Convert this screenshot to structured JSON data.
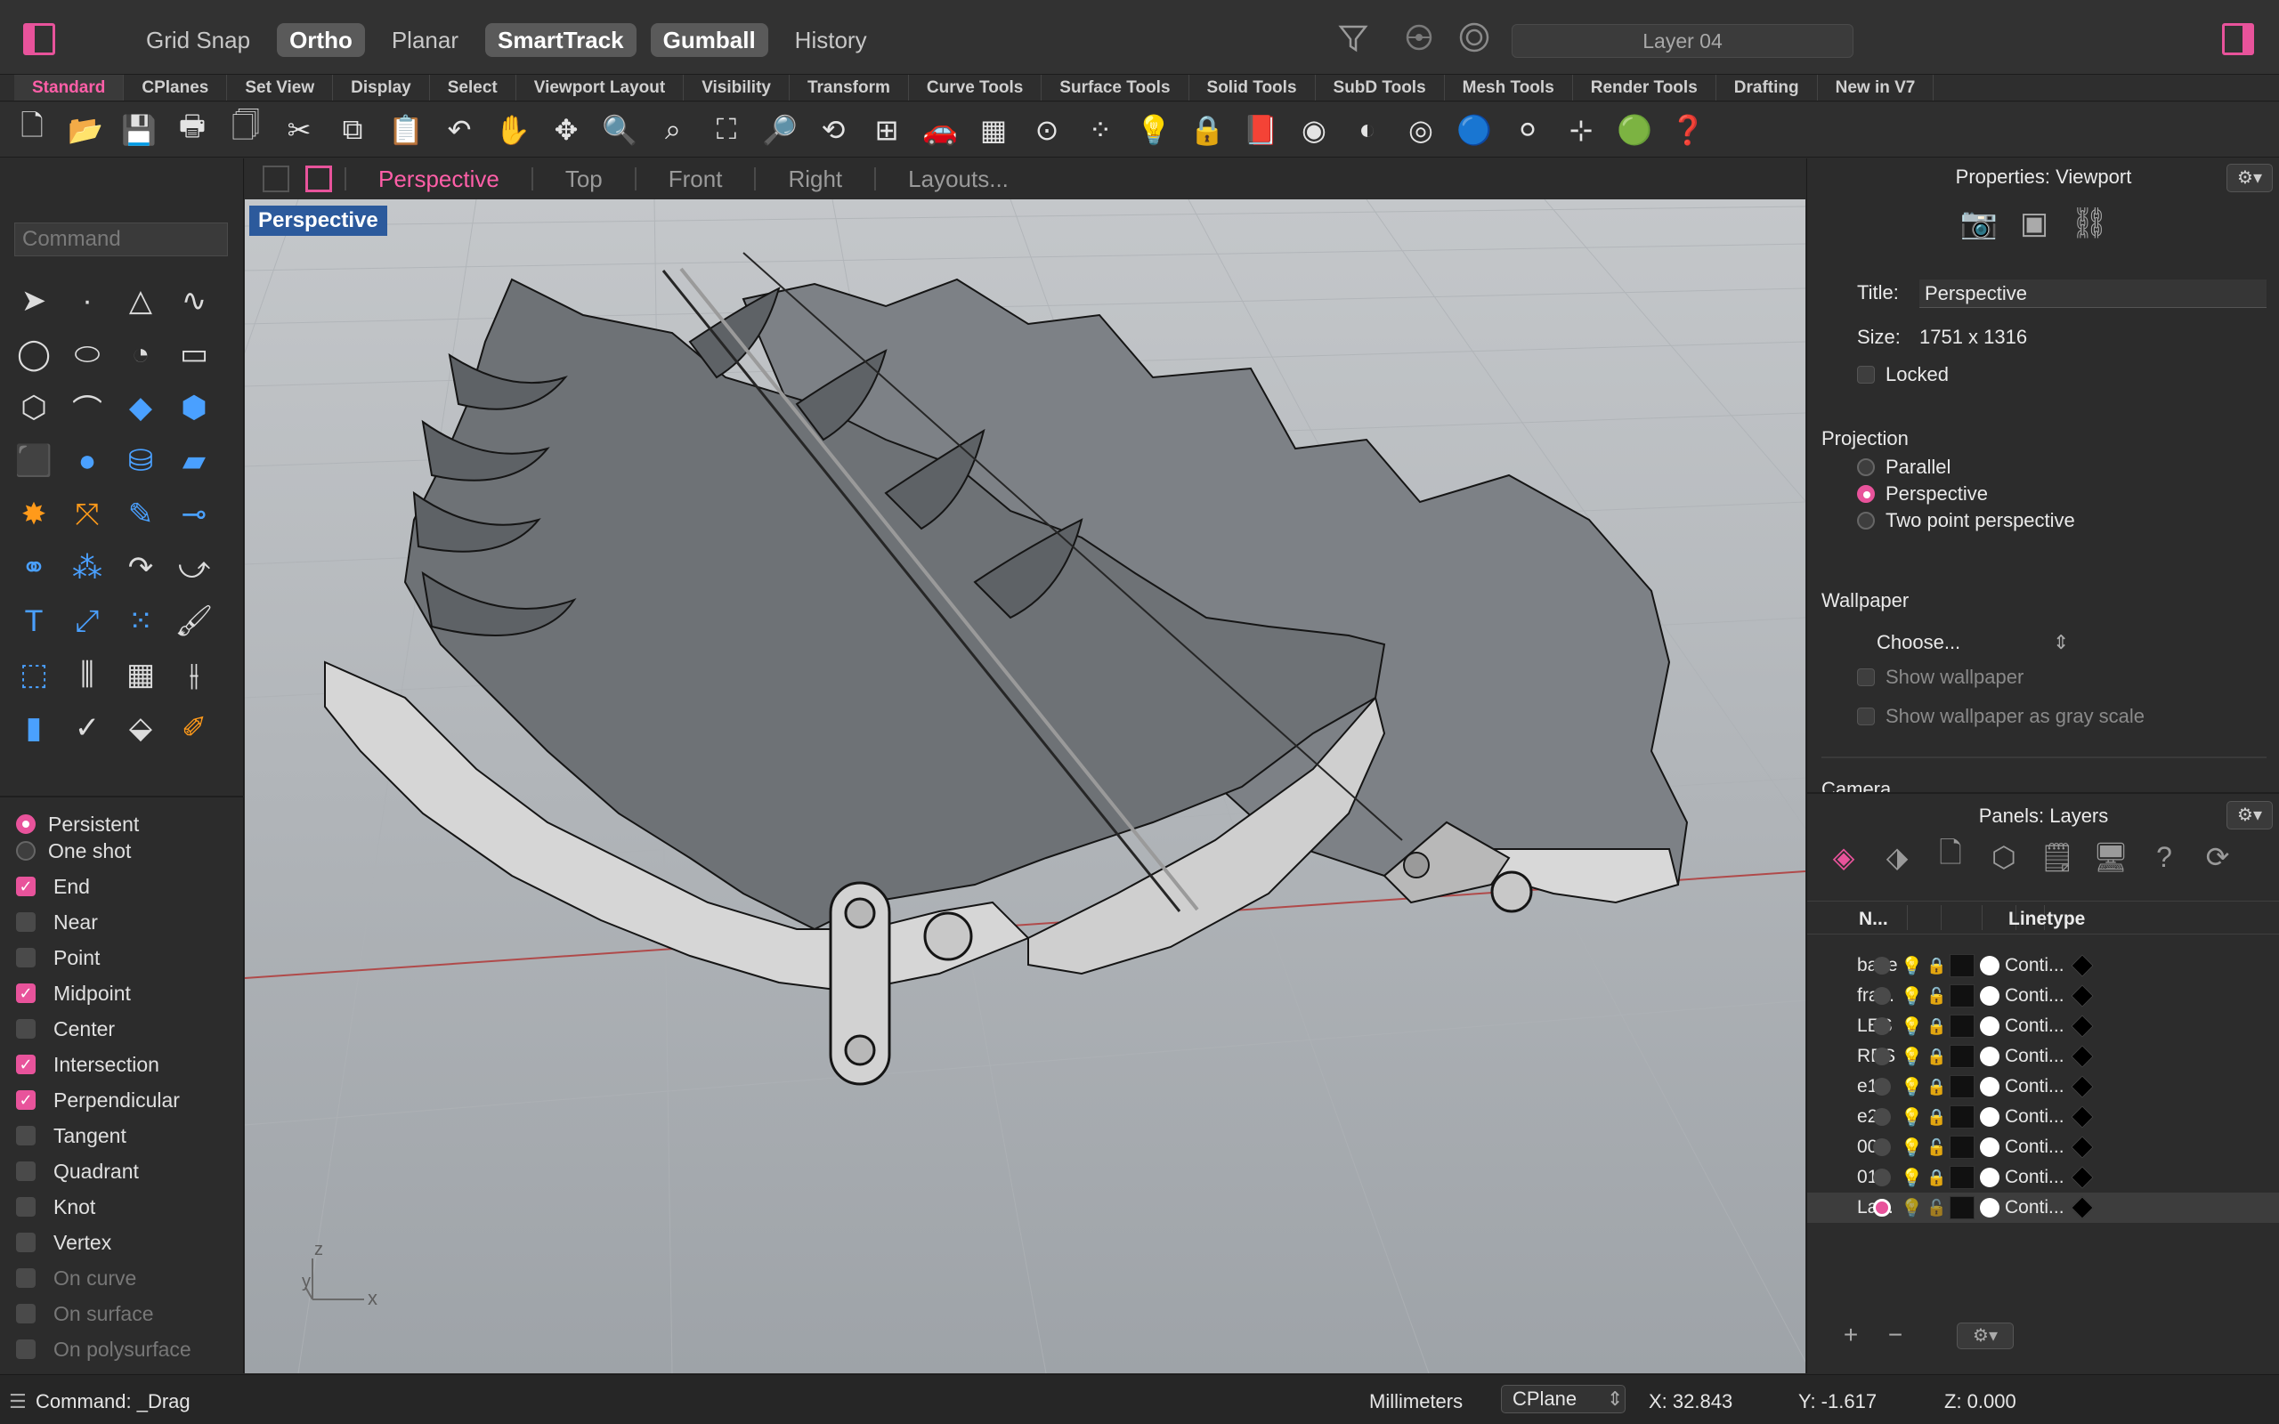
{
  "topbar": {
    "modes": [
      {
        "label": "Grid Snap",
        "on": false
      },
      {
        "label": "Ortho",
        "on": true
      },
      {
        "label": "Planar",
        "on": false
      },
      {
        "label": "SmartTrack",
        "on": true
      },
      {
        "label": "Gumball",
        "on": true
      },
      {
        "label": "History",
        "on": false
      }
    ],
    "current_layer": "Layer 04",
    "accent": "#e8539b"
  },
  "tabs": [
    "Standard",
    "CPlanes",
    "Set View",
    "Display",
    "Select",
    "Viewport Layout",
    "Visibility",
    "Transform",
    "Curve Tools",
    "Surface Tools",
    "Solid Tools",
    "SubD Tools",
    "Mesh Tools",
    "Render Tools",
    "Drafting",
    "New in V7"
  ],
  "active_tab": "Standard",
  "left": {
    "command_placeholder": "Command",
    "osnap_mode": [
      {
        "label": "Persistent",
        "on": true
      },
      {
        "label": "One shot",
        "on": false
      }
    ],
    "osnaps": [
      {
        "label": "End",
        "checked": true,
        "enabled": true
      },
      {
        "label": "Near",
        "checked": false,
        "enabled": true
      },
      {
        "label": "Point",
        "checked": false,
        "enabled": true
      },
      {
        "label": "Midpoint",
        "checked": true,
        "enabled": true
      },
      {
        "label": "Center",
        "checked": false,
        "enabled": true
      },
      {
        "label": "Intersection",
        "checked": true,
        "enabled": true
      },
      {
        "label": "Perpendicular",
        "checked": true,
        "enabled": true
      },
      {
        "label": "Tangent",
        "checked": false,
        "enabled": true
      },
      {
        "label": "Quadrant",
        "checked": false,
        "enabled": true
      },
      {
        "label": "Knot",
        "checked": false,
        "enabled": true
      },
      {
        "label": "Vertex",
        "checked": false,
        "enabled": true
      },
      {
        "label": "On curve",
        "checked": false,
        "enabled": false
      },
      {
        "label": "On surface",
        "checked": false,
        "enabled": false
      },
      {
        "label": "On polysurface",
        "checked": false,
        "enabled": false
      }
    ]
  },
  "viewport": {
    "tabs": [
      "Perspective",
      "Top",
      "Front",
      "Right",
      "Layouts..."
    ],
    "active": "Perspective",
    "label": "Perspective",
    "axis_z": "z",
    "axis_y": "y",
    "axis_x": "x"
  },
  "properties": {
    "title": "Properties: Viewport",
    "title_label": "Title:",
    "title_value": "Perspective",
    "size_label": "Size:",
    "size_value": "1751 x 1316",
    "locked_label": "Locked",
    "projection_label": "Projection",
    "projections": [
      {
        "label": "Parallel",
        "on": false
      },
      {
        "label": "Perspective",
        "on": true
      },
      {
        "label": "Two point perspective",
        "on": false
      }
    ],
    "wallpaper_label": "Wallpaper",
    "wallpaper_choose": "Choose...",
    "show_wallpaper": "Show wallpaper",
    "show_gray": "Show wallpaper as gray scale",
    "camera_label": "Camera"
  },
  "layers": {
    "title": "Panels: Layers",
    "col_name": "N...",
    "col_linetype": "Linetype",
    "rows": [
      {
        "name": "bake",
        "bulb": "white",
        "linetype": "Conti...",
        "current": false
      },
      {
        "name": "fra...",
        "bulb": "white",
        "linetype": "Conti...",
        "current": false
      },
      {
        "name": "LES",
        "bulb": "white",
        "linetype": "Conti...",
        "current": false
      },
      {
        "name": "RES",
        "bulb": "white",
        "linetype": "Conti...",
        "current": false
      },
      {
        "name": "e1",
        "bulb": "white",
        "linetype": "Conti...",
        "current": false
      },
      {
        "name": "e2",
        "bulb": "white",
        "linetype": "Conti...",
        "current": false
      },
      {
        "name": "00",
        "bulb": "yellow",
        "linetype": "Conti...",
        "current": false
      },
      {
        "name": "01",
        "bulb": "yellow",
        "linetype": "Conti...",
        "current": false
      },
      {
        "name": "La...",
        "bulb": "yellow",
        "linetype": "Conti...",
        "current": true
      }
    ]
  },
  "status": {
    "command": "Command: _Drag",
    "units": "Millimeters",
    "cplane": "CPlane",
    "x": "X: 32.843",
    "y": "Y: -1.617",
    "z": "Z: 0.000"
  }
}
